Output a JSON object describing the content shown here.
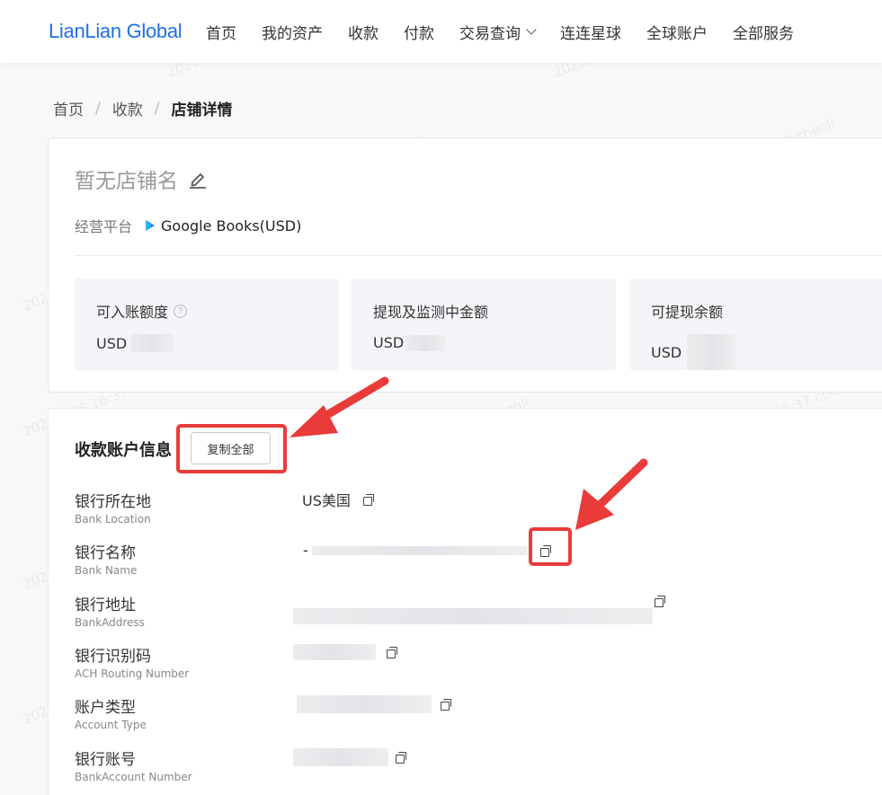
{
  "header": {
    "logo": "LianLian Global",
    "nav": [
      {
        "label": "首页"
      },
      {
        "label": "我的资产"
      },
      {
        "label": "收款"
      },
      {
        "label": "付款"
      },
      {
        "label": "交易查询",
        "has_dropdown": true
      },
      {
        "label": "连连星球"
      },
      {
        "label": "全球账户"
      },
      {
        "label": "全部服务"
      }
    ]
  },
  "breadcrumb": [
    "首页",
    "收款",
    "店铺详情"
  ],
  "store": {
    "name": "暂无店铺名",
    "platform_label": "经营平台",
    "platform_value": "Google Books(USD)"
  },
  "stats": [
    {
      "title": "可入账额度",
      "currency": "USD",
      "has_help": true
    },
    {
      "title": "提现及监测中金额",
      "currency": "USD"
    },
    {
      "title": "可提现余额",
      "currency": "USD"
    }
  ],
  "account": {
    "title": "收款账户信息",
    "copy_all": "复制全部",
    "rows": [
      {
        "zh": "银行所在地",
        "en": "Bank Location",
        "value": "US美国"
      },
      {
        "zh": "银行名称",
        "en": "Bank Name",
        "value": "-"
      },
      {
        "zh": "银行地址",
        "en": "BankAddress",
        "value": ""
      },
      {
        "zh": "银行识别码",
        "en": "ACH Routing Number",
        "value": ""
      },
      {
        "zh": "账户类型",
        "en": "Account Type",
        "value": ""
      },
      {
        "zh": "银行账号",
        "en": "BankAccount Number",
        "value": ""
      }
    ]
  },
  "colors": {
    "brand": "#1f6fe5",
    "annotation": "#ea3b3b"
  }
}
